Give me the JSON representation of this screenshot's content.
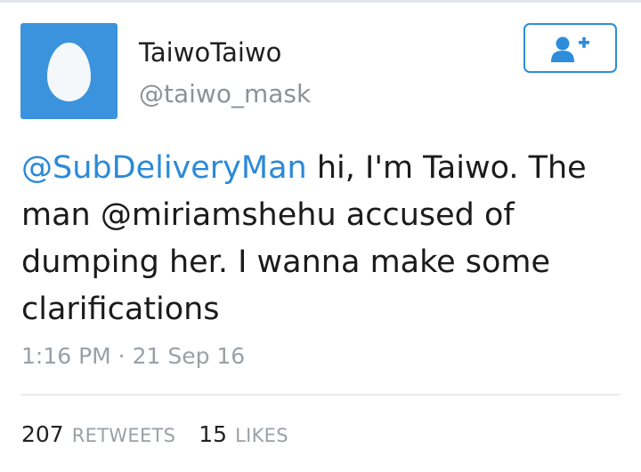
{
  "tweet": {
    "author": {
      "display_name": "TaiwoTaiwo",
      "handle": "@taiwo_mask"
    },
    "follow_button": {
      "icon": "add-user-icon"
    },
    "text": {
      "mention": "@SubDeliveryMan",
      "body": " hi, I'm Taiwo. The man @miriamshehu accused of dumping her. I wanna make some clarifications"
    },
    "timestamp": "1:16 PM · 21 Sep 16",
    "stats": {
      "retweets_count": "207",
      "retweets_label": "RETWEETS",
      "likes_count": "15",
      "likes_label": "LIKES"
    }
  },
  "colors": {
    "accent": "#2b8ad8",
    "avatar_bg": "#3b93dd",
    "muted_text": "#9aa0a6"
  }
}
